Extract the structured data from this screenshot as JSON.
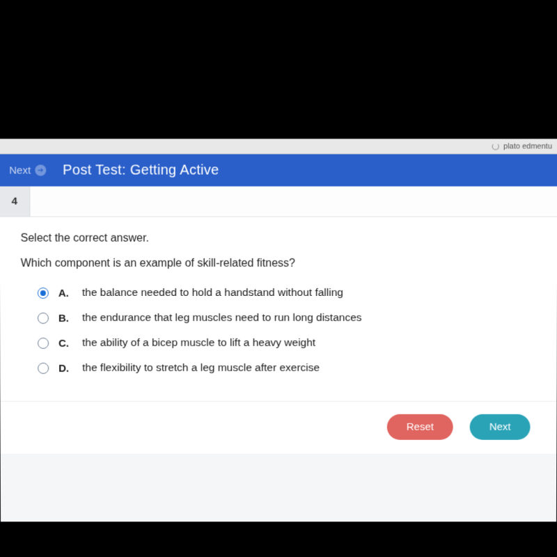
{
  "browser": {
    "tab_label_fragment": "plato edmentu"
  },
  "header": {
    "next_label": "Next",
    "test_title": "Post Test: Getting Active"
  },
  "question": {
    "number": "4",
    "instruction": "Select the correct answer.",
    "prompt": "Which component is an example of skill-related fitness?",
    "options": [
      {
        "letter": "A.",
        "text": "the balance needed to hold a handstand without falling",
        "selected": true
      },
      {
        "letter": "B.",
        "text": "the endurance that leg muscles need to run long distances",
        "selected": false
      },
      {
        "letter": "C.",
        "text": "the ability of a bicep muscle to lift a heavy weight",
        "selected": false
      },
      {
        "letter": "D.",
        "text": "the flexibility to stretch a leg muscle after exercise",
        "selected": false
      }
    ]
  },
  "footer": {
    "reset_label": "Reset",
    "next_label": "Next"
  }
}
